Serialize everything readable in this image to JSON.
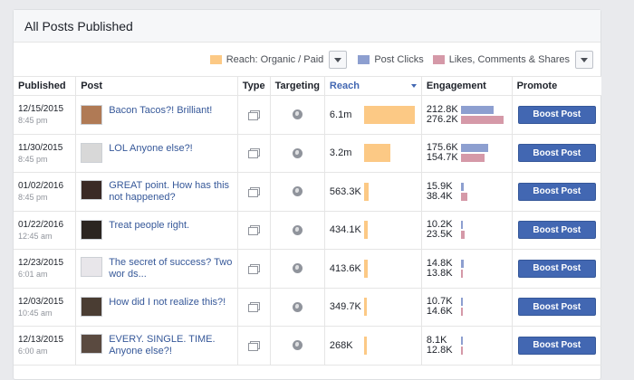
{
  "header": {
    "title": "All Posts Published"
  },
  "legend": {
    "items": [
      {
        "label": "Reach: Organic / Paid",
        "color": "#fcc985"
      },
      {
        "label": "Post Clicks",
        "color": "#8d9fd0"
      },
      {
        "label": "Likes, Comments & Shares",
        "color": "#d599a8"
      }
    ]
  },
  "columns": {
    "published": "Published",
    "post": "Post",
    "type": "Type",
    "targeting": "Targeting",
    "reach": "Reach",
    "engagement": "Engagement",
    "promote": "Promote"
  },
  "rows": [
    {
      "date": "12/15/2015",
      "time": "8:45 pm",
      "post": "Bacon Tacos?! Brilliant!",
      "reach": "6.1m",
      "reach_frac": 1.0,
      "clicks": "212.8K",
      "likes": "276.2K",
      "clicks_frac": 0.77,
      "likes_frac": 1.0,
      "promote": "Boost Post",
      "thumb": "#b07a55"
    },
    {
      "date": "11/30/2015",
      "time": "8:45 pm",
      "post": "LOL Anyone else?!",
      "reach": "3.2m",
      "reach_frac": 0.52,
      "clicks": "175.6K",
      "likes": "154.7K",
      "clicks_frac": 0.63,
      "likes_frac": 0.56,
      "promote": "Boost Post",
      "thumb": "#d8d8d8"
    },
    {
      "date": "01/02/2016",
      "time": "8:45 pm",
      "post": "GREAT point. How has this not happened?",
      "reach": "563.3K",
      "reach_frac": 0.09,
      "clicks": "15.9K",
      "likes": "38.4K",
      "clicks_frac": 0.06,
      "likes_frac": 0.14,
      "promote": "Boost Post",
      "thumb": "#3a2a26"
    },
    {
      "date": "01/22/2016",
      "time": "12:45 am",
      "post": "Treat people right.",
      "reach": "434.1K",
      "reach_frac": 0.07,
      "clicks": "10.2K",
      "likes": "23.5K",
      "clicks_frac": 0.04,
      "likes_frac": 0.09,
      "promote": "Boost Post",
      "thumb": "#2b2521"
    },
    {
      "date": "12/23/2015",
      "time": "6:01 am",
      "post": "The secret of success? Two wor ds...",
      "reach": "413.6K",
      "reach_frac": 0.068,
      "clicks": "14.8K",
      "likes": "13.8K",
      "clicks_frac": 0.055,
      "likes_frac": 0.05,
      "promote": "Boost Post",
      "thumb": "#e8e6ea"
    },
    {
      "date": "12/03/2015",
      "time": "10:45 am",
      "post": "How did I not realize this?!",
      "reach": "349.7K",
      "reach_frac": 0.057,
      "clicks": "10.7K",
      "likes": "14.6K",
      "clicks_frac": 0.04,
      "likes_frac": 0.053,
      "promote": "Boost Post",
      "thumb": "#4a3d33"
    },
    {
      "date": "12/13/2015",
      "time": "6:00 am",
      "post": "EVERY. SINGLE. TIME. Anyone else?!",
      "reach": "268K",
      "reach_frac": 0.044,
      "clicks": "8.1K",
      "likes": "12.8K",
      "clicks_frac": 0.03,
      "likes_frac": 0.046,
      "promote": "Boost Post",
      "thumb": "#5a4a40"
    }
  ]
}
